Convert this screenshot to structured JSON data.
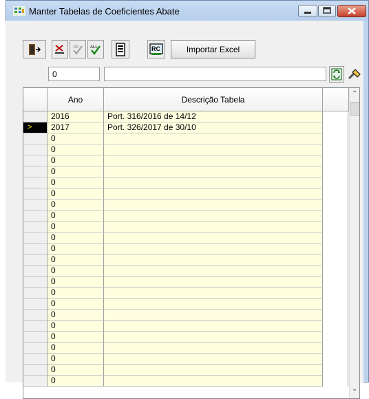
{
  "window": {
    "title": "Manter Tabelas de Coeficientes Abate"
  },
  "toolbar": {
    "import_label": "Importar Excel"
  },
  "filter": {
    "code_value": "0",
    "description_value": ""
  },
  "table": {
    "columns": [
      "Ano",
      "Descrição Tabela"
    ],
    "current_indicator": ">",
    "rows": [
      {
        "ano": "2016",
        "descricao": "Port. 316/2016 de 14/12",
        "current": false
      },
      {
        "ano": "2017",
        "descricao": "Port. 326/2017 de 30/10",
        "current": true
      },
      {
        "ano": "0",
        "descricao": "",
        "current": false
      },
      {
        "ano": "0",
        "descricao": "",
        "current": false
      },
      {
        "ano": "0",
        "descricao": "",
        "current": false
      },
      {
        "ano": "0",
        "descricao": "",
        "current": false
      },
      {
        "ano": "0",
        "descricao": "",
        "current": false
      },
      {
        "ano": "0",
        "descricao": "",
        "current": false
      },
      {
        "ano": "0",
        "descricao": "",
        "current": false
      },
      {
        "ano": "0",
        "descricao": "",
        "current": false
      },
      {
        "ano": "0",
        "descricao": "",
        "current": false
      },
      {
        "ano": "0",
        "descricao": "",
        "current": false
      },
      {
        "ano": "0",
        "descricao": "",
        "current": false
      },
      {
        "ano": "0",
        "descricao": "",
        "current": false
      },
      {
        "ano": "0",
        "descricao": "",
        "current": false
      },
      {
        "ano": "0",
        "descricao": "",
        "current": false
      },
      {
        "ano": "0",
        "descricao": "",
        "current": false
      },
      {
        "ano": "0",
        "descricao": "",
        "current": false
      },
      {
        "ano": "0",
        "descricao": "",
        "current": false
      },
      {
        "ano": "0",
        "descricao": "",
        "current": false
      },
      {
        "ano": "0",
        "descricao": "",
        "current": false
      },
      {
        "ano": "0",
        "descricao": "",
        "current": false
      },
      {
        "ano": "0",
        "descricao": "",
        "current": false
      },
      {
        "ano": "0",
        "descricao": "",
        "current": false
      },
      {
        "ano": "0",
        "descricao": "",
        "current": false
      }
    ]
  },
  "icons": [
    "exit-icon",
    "delete-icon",
    "ok-icon",
    "confirm-all-icon",
    "report-icon",
    "rc-icon",
    "refresh-icon",
    "clear-brush-icon",
    "scroll-up-icon",
    "scroll-down-icon"
  ]
}
